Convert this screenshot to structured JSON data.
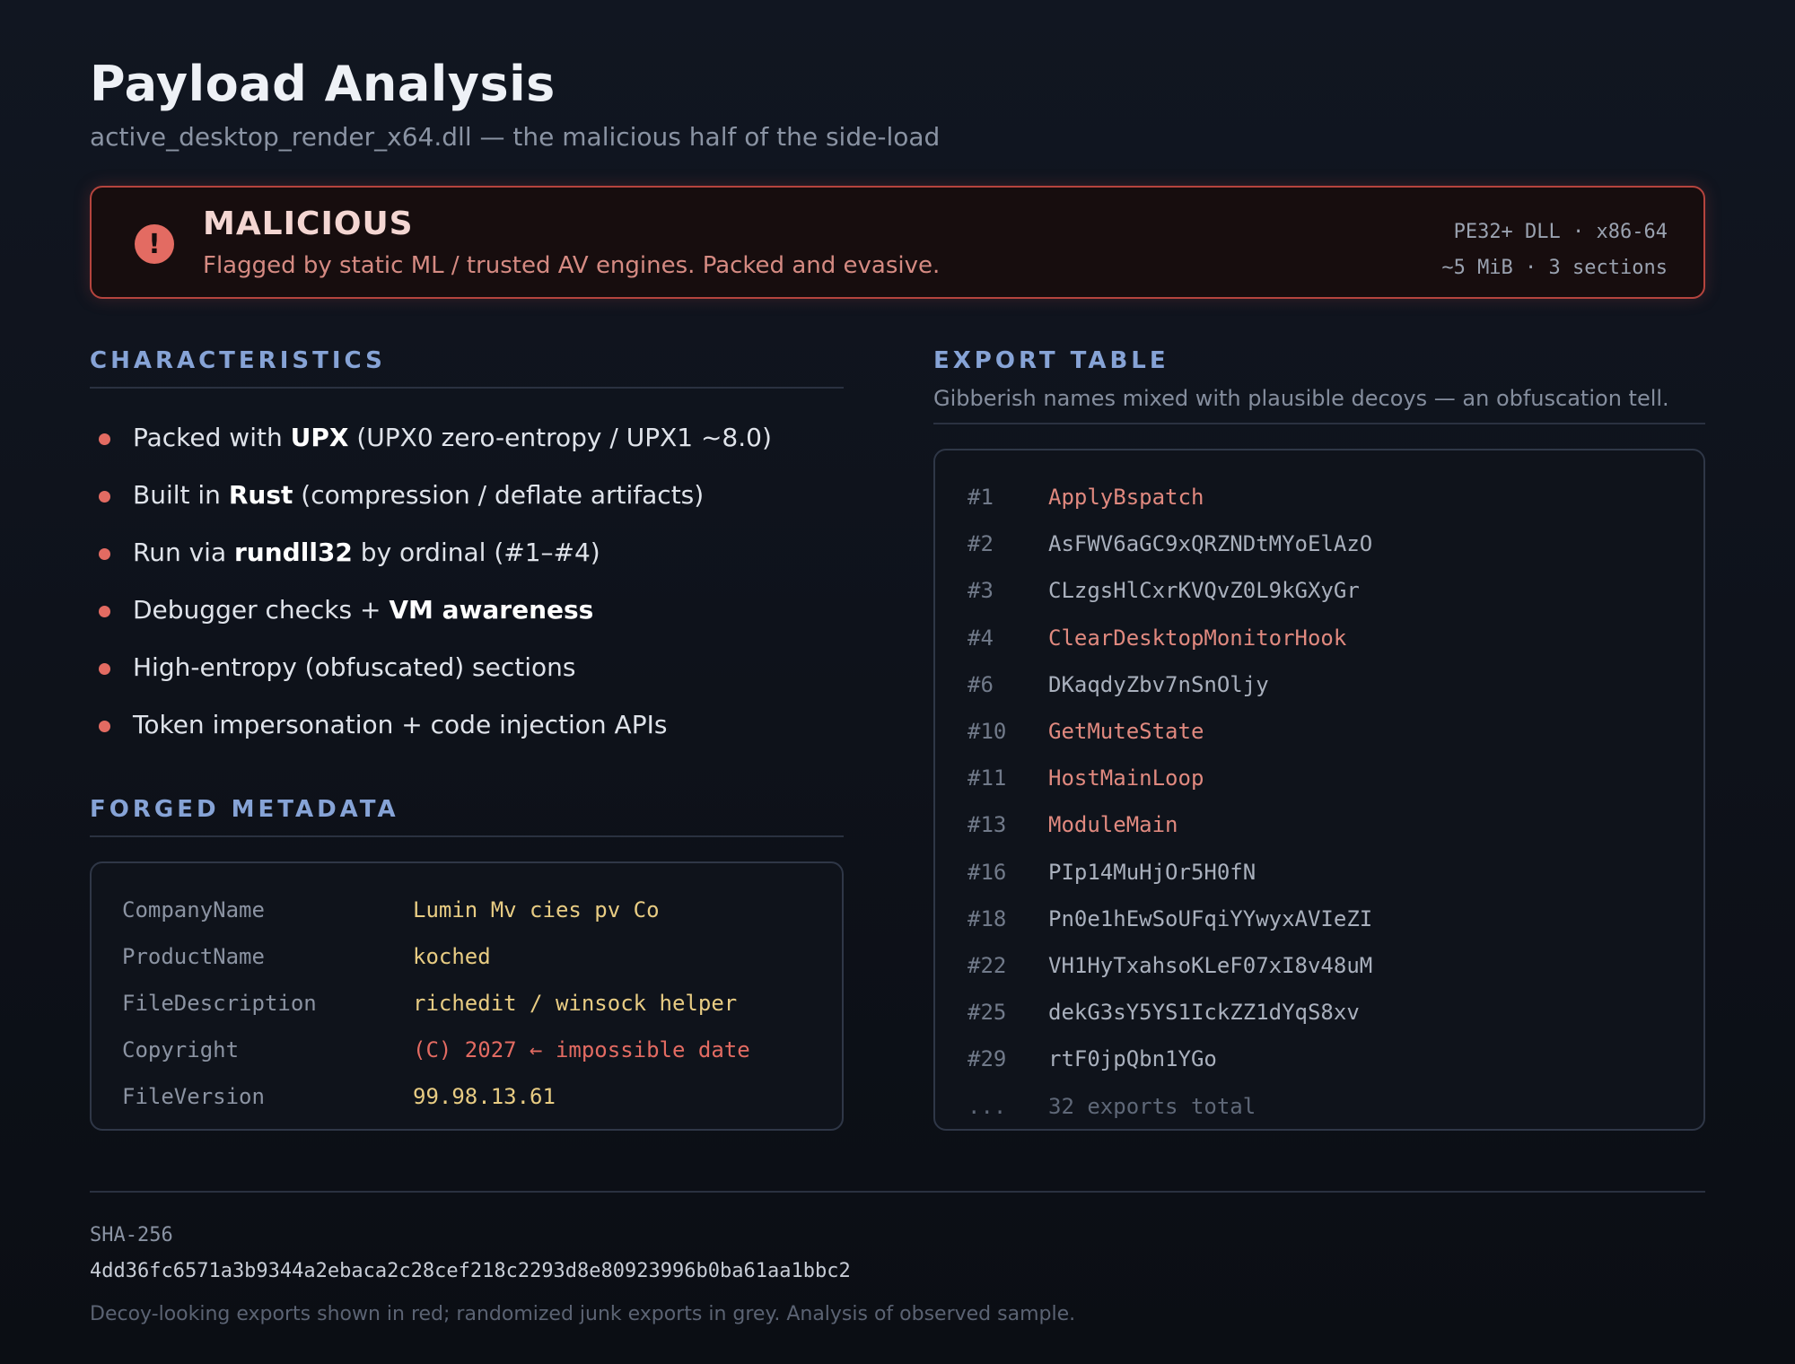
{
  "header": {
    "title": "Payload Analysis",
    "subtitle": "active_desktop_render_x64.dll — the malicious half of the side-load"
  },
  "verdict": {
    "icon": "alert-icon",
    "icon_glyph": "!",
    "label": "MALICIOUS",
    "description": "Flagged by static ML / trusted AV engines. Packed and evasive.",
    "meta_line1": "PE32+ DLL · x86-64",
    "meta_line2": "~5 MiB · 3 sections",
    "accent_color": "#e36b62"
  },
  "characteristics": {
    "heading": "CHARACTERISTICS",
    "items": [
      {
        "pre": "Packed with ",
        "bold": "UPX",
        "post": " (UPX0 zero-entropy / UPX1 ~8.0)"
      },
      {
        "pre": "Built in ",
        "bold": "Rust",
        "post": " (compression / deflate artifacts)"
      },
      {
        "pre": "Run via ",
        "bold": "rundll32",
        "post": " by ordinal (#1–#4)"
      },
      {
        "pre": "Debugger checks + ",
        "bold": "VM awareness",
        "post": ""
      },
      {
        "pre": "High-entropy (obfuscated) sections",
        "bold": "",
        "post": ""
      },
      {
        "pre": "Token impersonation + code injection APIs",
        "bold": "",
        "post": ""
      }
    ]
  },
  "forged_metadata": {
    "heading": "FORGED METADATA",
    "rows": [
      {
        "key": "CompanyName",
        "value": "Lumin Mv cies pv Co",
        "flag": false
      },
      {
        "key": "ProductName",
        "value": "koched",
        "flag": false
      },
      {
        "key": "FileDescription",
        "value": "richedit / winsock helper",
        "flag": false
      },
      {
        "key": "Copyright",
        "value": "(C) 2027 ← impossible date",
        "flag": true
      },
      {
        "key": "FileVersion",
        "value": "99.98.13.61",
        "flag": false
      }
    ]
  },
  "export_table": {
    "heading": "EXPORT TABLE",
    "description": "Gibberish names mixed with plausible decoys — an obfuscation tell.",
    "rows": [
      {
        "ordinal": "#1",
        "name": "ApplyBspatch",
        "decoy": true
      },
      {
        "ordinal": "#2",
        "name": "AsFWV6aGC9xQRZNDtMYoElAzO",
        "decoy": false
      },
      {
        "ordinal": "#3",
        "name": "CLzgsHlCxrKVQvZ0L9kGXyGr",
        "decoy": false
      },
      {
        "ordinal": "#4",
        "name": "ClearDesktopMonitorHook",
        "decoy": true
      },
      {
        "ordinal": "#6",
        "name": "DKaqdyZbv7nSnOljy",
        "decoy": false
      },
      {
        "ordinal": "#10",
        "name": "GetMuteState",
        "decoy": true
      },
      {
        "ordinal": "#11",
        "name": "HostMainLoop",
        "decoy": true
      },
      {
        "ordinal": "#13",
        "name": "ModuleMain",
        "decoy": true
      },
      {
        "ordinal": "#16",
        "name": "PIp14MuHjOr5H0fN",
        "decoy": false
      },
      {
        "ordinal": "#18",
        "name": "Pn0e1hEwSoUFqiYYwyxAVIeZI",
        "decoy": false
      },
      {
        "ordinal": "#22",
        "name": "VH1HyTxahsoKLeF07xI8v48uM",
        "decoy": false
      },
      {
        "ordinal": "#25",
        "name": "dekG3sY5YS1IckZZ1dYqS8xv",
        "decoy": false
      },
      {
        "ordinal": "#29",
        "name": "rtF0jpQbn1YGo",
        "decoy": false
      }
    ],
    "total_ordinal": "...",
    "total_label": "32 exports total"
  },
  "footer": {
    "sha_label": "SHA-256",
    "sha_value": "4dd36fc6571a3b9344a2ebaca2c28cef218c2293d8e80923996b0ba61aa1bbc2",
    "note": "Decoy-looking exports shown in red; randomized junk exports in grey. Analysis of observed sample."
  }
}
